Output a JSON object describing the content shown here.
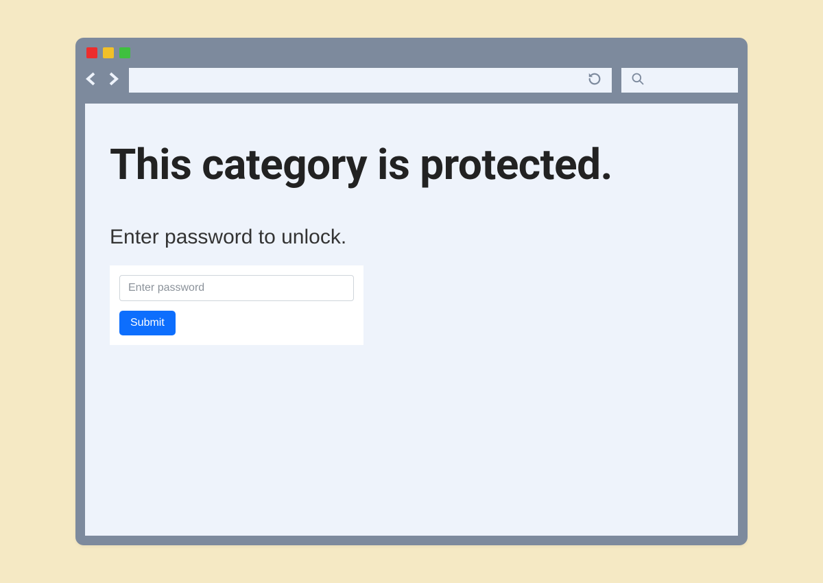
{
  "browser": {
    "url_value": "",
    "search_value": ""
  },
  "page": {
    "title": "This category is protected.",
    "subtitle": "Enter password to unlock.",
    "form": {
      "password_placeholder": "Enter password",
      "password_value": "",
      "submit_label": "Submit"
    }
  },
  "colors": {
    "chrome": "#7d8a9d",
    "content_bg": "#eef3fb",
    "page_bg": "#f5e9c4",
    "primary": "#0d6efd"
  }
}
